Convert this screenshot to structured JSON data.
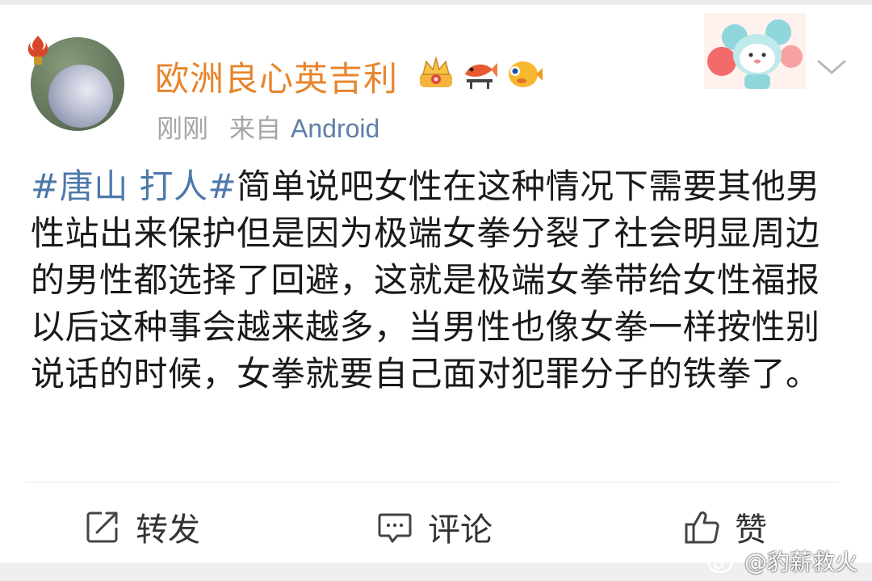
{
  "post": {
    "author": {
      "username": "欧洲良心英吉利",
      "badges": [
        "crown-badge",
        "fish-badge",
        "pufferfish-badge"
      ]
    },
    "meta": {
      "time": "刚刚",
      "source_prefix": "来自",
      "source": "Android"
    },
    "content": {
      "hashtag": "#唐山 打人#",
      "text": "简单说吧女性在这种情况下需要其他男性站出来保护但是因为极端女拳分裂了社会明显周边的男性都选择了回避，这就是极端女拳带给女性福报以后这种事会越来越多，当男性也像女拳一样按性别说话的时候，女拳就要自己面对犯罪分子的铁拳了。"
    },
    "actions": {
      "repost_label": "转发",
      "comment_label": "评论",
      "like_label": "赞"
    }
  },
  "watermark": {
    "text": "@豹薪救火"
  },
  "colors": {
    "username": "#e8842b",
    "hashtag": "#4d78ab",
    "source_link": "#5d7fa8",
    "meta_gray": "#a6a6a6",
    "body_text": "#1a1a1a"
  }
}
